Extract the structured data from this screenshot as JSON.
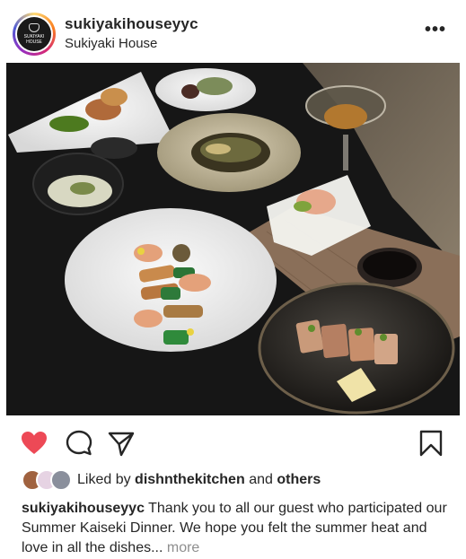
{
  "post": {
    "username": "sukiyakihouseyyc",
    "location": "Sukiyaki House",
    "avatar_text_line1": "SUKIYAKI",
    "avatar_text_line2": "HOUSE",
    "more_icon": "more-horizontal-icon"
  },
  "actions": {
    "like_icon": "heart-filled-icon",
    "comment_icon": "comment-icon",
    "share_icon": "send-icon",
    "save_icon": "bookmark-icon",
    "like_color": "#ed4956"
  },
  "likes": {
    "prefix": "Liked by",
    "user": "dishnthekitchen",
    "and_word": "and",
    "others": "others"
  },
  "caption": {
    "username": "sukiyakihouseyyc",
    "text": "Thank you to all our guest who participated our Summer Kaiseki Dinner. We hope you felt the summer heat and love in all the dishes...",
    "more_label": "more"
  }
}
